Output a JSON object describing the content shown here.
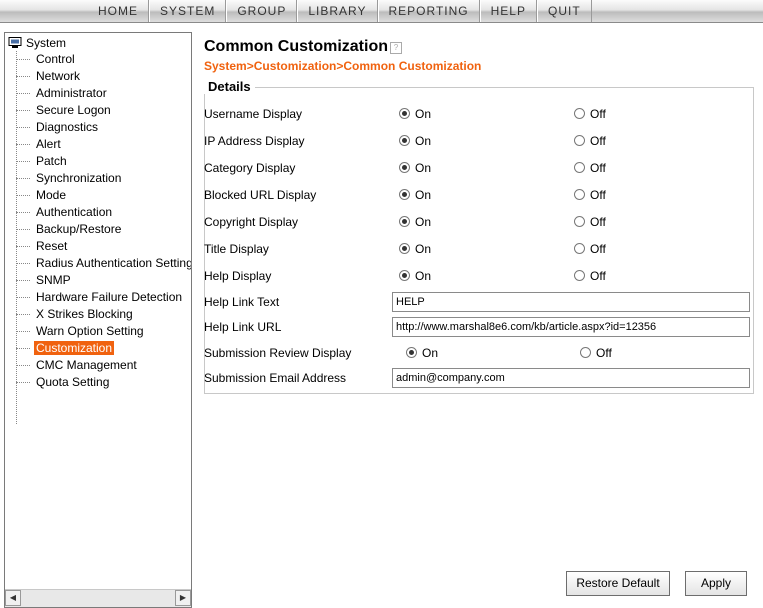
{
  "nav": {
    "items": [
      "HOME",
      "SYSTEM",
      "GROUP",
      "LIBRARY",
      "REPORTING",
      "HELP",
      "QUIT"
    ]
  },
  "tree": {
    "root_label": "System",
    "items": [
      "Control",
      "Network",
      "Administrator",
      "Secure Logon",
      "Diagnostics",
      "Alert",
      "Patch",
      "Synchronization",
      "Mode",
      "Authentication",
      "Backup/Restore",
      "Reset",
      "Radius Authentication Setting",
      "SNMP",
      "Hardware Failure Detection",
      "X Strikes Blocking",
      "Warn Option Setting",
      "Customization",
      "CMC Management",
      "Quota Setting"
    ],
    "selected": "Customization"
  },
  "page": {
    "title": "Common Customization",
    "breadcrumb": "System>Customization>Common Customization",
    "section": "Details"
  },
  "settings": [
    {
      "label": "Username Display",
      "on": "On",
      "off": "Off",
      "value": "On"
    },
    {
      "label": "IP Address Display",
      "on": "On",
      "off": "Off",
      "value": "On"
    },
    {
      "label": "Category Display",
      "on": "On",
      "off": "Off",
      "value": "On"
    },
    {
      "label": "Blocked URL Display",
      "on": "On",
      "off": "Off",
      "value": "On"
    },
    {
      "label": "Copyright Display",
      "on": "On",
      "off": "Off",
      "value": "On"
    },
    {
      "label": "Title Display",
      "on": "On",
      "off": "Off",
      "value": "On"
    },
    {
      "label": "Help Display",
      "on": "On",
      "off": "Off",
      "value": "On"
    }
  ],
  "help_link_text": {
    "label": "Help Link Text",
    "value": "HELP"
  },
  "help_link_url": {
    "label": "Help Link URL",
    "value": "http://www.marshal8e6.com/kb/article.aspx?id=12356"
  },
  "submission_review": {
    "label": "Submission Review Display",
    "on": "On",
    "off": "Off",
    "value": "On"
  },
  "submission_email": {
    "label": "Submission Email Address",
    "value": "admin@company.com"
  },
  "buttons": {
    "restore": "Restore Default",
    "apply": "Apply"
  }
}
